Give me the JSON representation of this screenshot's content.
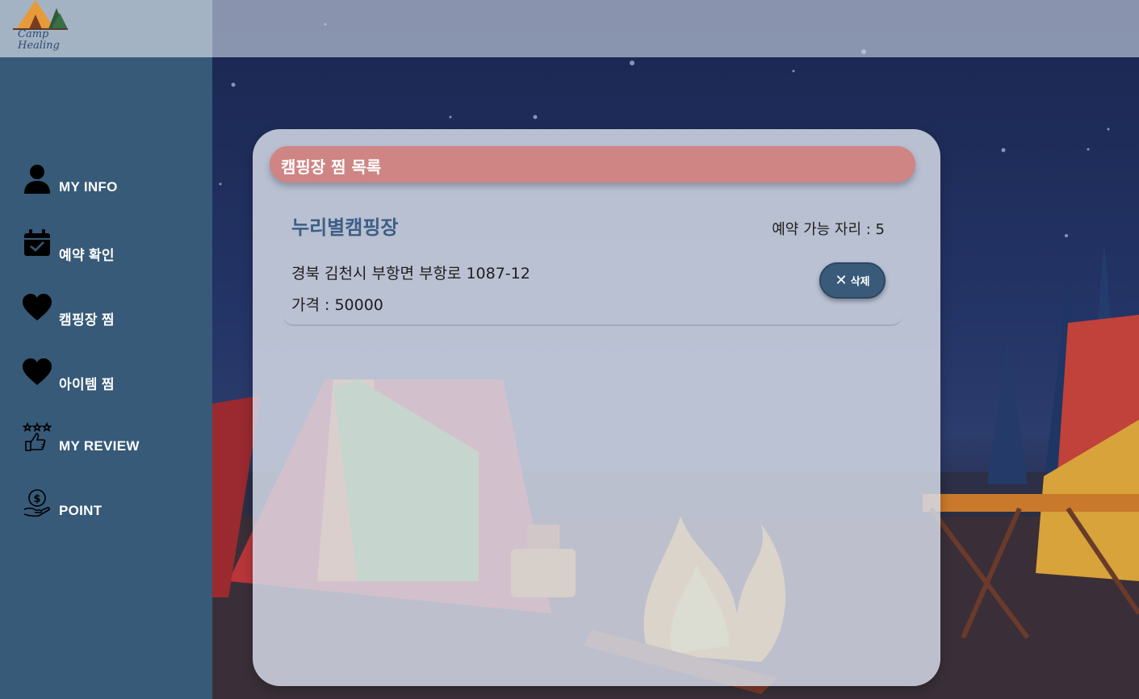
{
  "logo": {
    "text_line1": "Camp",
    "text_line2": "Healing"
  },
  "sidebar": {
    "items": [
      {
        "label": "MY INFO",
        "icon": "user-icon"
      },
      {
        "label": "예약 확인",
        "icon": "calendar-check-icon"
      },
      {
        "label": "캠핑장 찜",
        "icon": "heart-icon"
      },
      {
        "label": "아이템 찜",
        "icon": "heart-icon"
      },
      {
        "label": "MY REVIEW",
        "icon": "thumbs-up-stars-icon"
      },
      {
        "label": "POINT",
        "icon": "coin-hand-icon"
      }
    ]
  },
  "main": {
    "title": "캠핑장 찜 목록",
    "items": [
      {
        "name": "누리별캠핑장",
        "seats_text": "예약 가능 자리 : 5",
        "address": "경북 김천시 부항면 부항로 1087-12",
        "price_text": "가격 : 50000",
        "delete_label": "삭제"
      }
    ]
  },
  "colors": {
    "sidebar": "#365a78",
    "title_bar": "#cf8584",
    "item_name": "#3d5e86",
    "delete_button": "#3a5a7a"
  }
}
